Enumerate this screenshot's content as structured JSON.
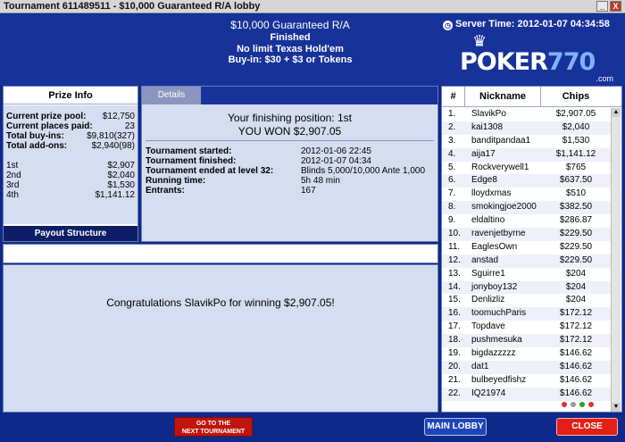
{
  "window": {
    "title": "Tournament 611489511 - $10,000 Guaranteed R/A lobby",
    "min": "_",
    "close": "X"
  },
  "header": {
    "name": "$10,000 Guaranteed R/A",
    "status": "Finished",
    "game": "No limit Texas Hold'em",
    "buyin": "Buy-in: $30 + $3 or Tokens",
    "server_time": "Server Time: 2012-01-07 04:34:58",
    "logo_word": "POKER",
    "logo_num": "770",
    "logo_suffix": ".com"
  },
  "prize_info": {
    "title": "Prize Info",
    "rows": [
      {
        "label": "Current prize pool:",
        "value": "$12,750"
      },
      {
        "label": "Current places paid:",
        "value": "23"
      },
      {
        "label": "Total buy-ins:",
        "value": "$9,810(327)"
      },
      {
        "label": "Total add-ons:",
        "value": "$2,940(98)"
      }
    ],
    "places": [
      {
        "label": "1st",
        "value": "$2,907"
      },
      {
        "label": "2nd",
        "value": "$2,040"
      },
      {
        "label": "3rd",
        "value": "$1,530"
      },
      {
        "label": "4th",
        "value": "$1,141.12"
      }
    ],
    "payout_button": "Payout Structure"
  },
  "details": {
    "tab": "Details",
    "finishing": "Your finishing position:  1st",
    "won": "YOU WON $2,907.05",
    "rows": [
      {
        "label": "Tournament started:",
        "value": "2012-01-06 22:45"
      },
      {
        "label": "Tournament finished:",
        "value": "2012-01-07 04:34"
      },
      {
        "label": "Tournament ended at level 32:",
        "value": "Blinds 5,000/10,000 Ante 1,000"
      },
      {
        "label": "Running time:",
        "value": "5h 48 min"
      },
      {
        "label": "Entrants:",
        "value": "167"
      }
    ]
  },
  "message": "Congratulations SlavikPo for winning $2,907.05!",
  "standings": {
    "headers": {
      "rank": "#",
      "nickname": "Nickname",
      "chips": "Chips"
    },
    "rows": [
      {
        "rank": "1.",
        "name": "SlavikPo",
        "chips": "$2,907.05"
      },
      {
        "rank": "2.",
        "name": "kai1308",
        "chips": "$2,040"
      },
      {
        "rank": "3.",
        "name": "banditpandaa1",
        "chips": "$1,530"
      },
      {
        "rank": "4.",
        "name": "aija17",
        "chips": "$1,141.12"
      },
      {
        "rank": "5.",
        "name": "Rockverywell1",
        "chips": "$765"
      },
      {
        "rank": "6.",
        "name": "Edge8",
        "chips": "$637.50"
      },
      {
        "rank": "7.",
        "name": "lloydxmas",
        "chips": "$510"
      },
      {
        "rank": "8.",
        "name": "smokingjoe2000",
        "chips": "$382.50"
      },
      {
        "rank": "9.",
        "name": "eldaltino",
        "chips": "$286.87"
      },
      {
        "rank": "10.",
        "name": "ravenjetbyrne",
        "chips": "$229.50"
      },
      {
        "rank": "11.",
        "name": "EaglesOwn",
        "chips": "$229.50"
      },
      {
        "rank": "12.",
        "name": "anstad",
        "chips": "$229.50"
      },
      {
        "rank": "13.",
        "name": "Sguirre1",
        "chips": "$204"
      },
      {
        "rank": "14.",
        "name": "jonyboy132",
        "chips": "$204"
      },
      {
        "rank": "15.",
        "name": "Denlizliz",
        "chips": "$204"
      },
      {
        "rank": "16.",
        "name": "toomuchParis",
        "chips": "$172.12"
      },
      {
        "rank": "17.",
        "name": "Topdave",
        "chips": "$172.12"
      },
      {
        "rank": "18.",
        "name": "pushmesuka",
        "chips": "$172.12"
      },
      {
        "rank": "19.",
        "name": "bigdazzzzz",
        "chips": "$146.62"
      },
      {
        "rank": "20.",
        "name": "dat1",
        "chips": "$146.62"
      },
      {
        "rank": "21.",
        "name": "bulbeyedfishz",
        "chips": "$146.62"
      },
      {
        "rank": "22.",
        "name": "IQ21974",
        "chips": "$146.62"
      }
    ]
  },
  "buttons": {
    "next_tournament_line1": "GO TO THE",
    "next_tournament_line2": "NEXT TOURNAMENT",
    "main_lobby": "MAIN LOBBY",
    "close": "CLOSE"
  },
  "colors": {
    "panel": "#d5ddf0",
    "header": "#17339a",
    "background": "#0d2a8a",
    "close": "#e42016"
  }
}
